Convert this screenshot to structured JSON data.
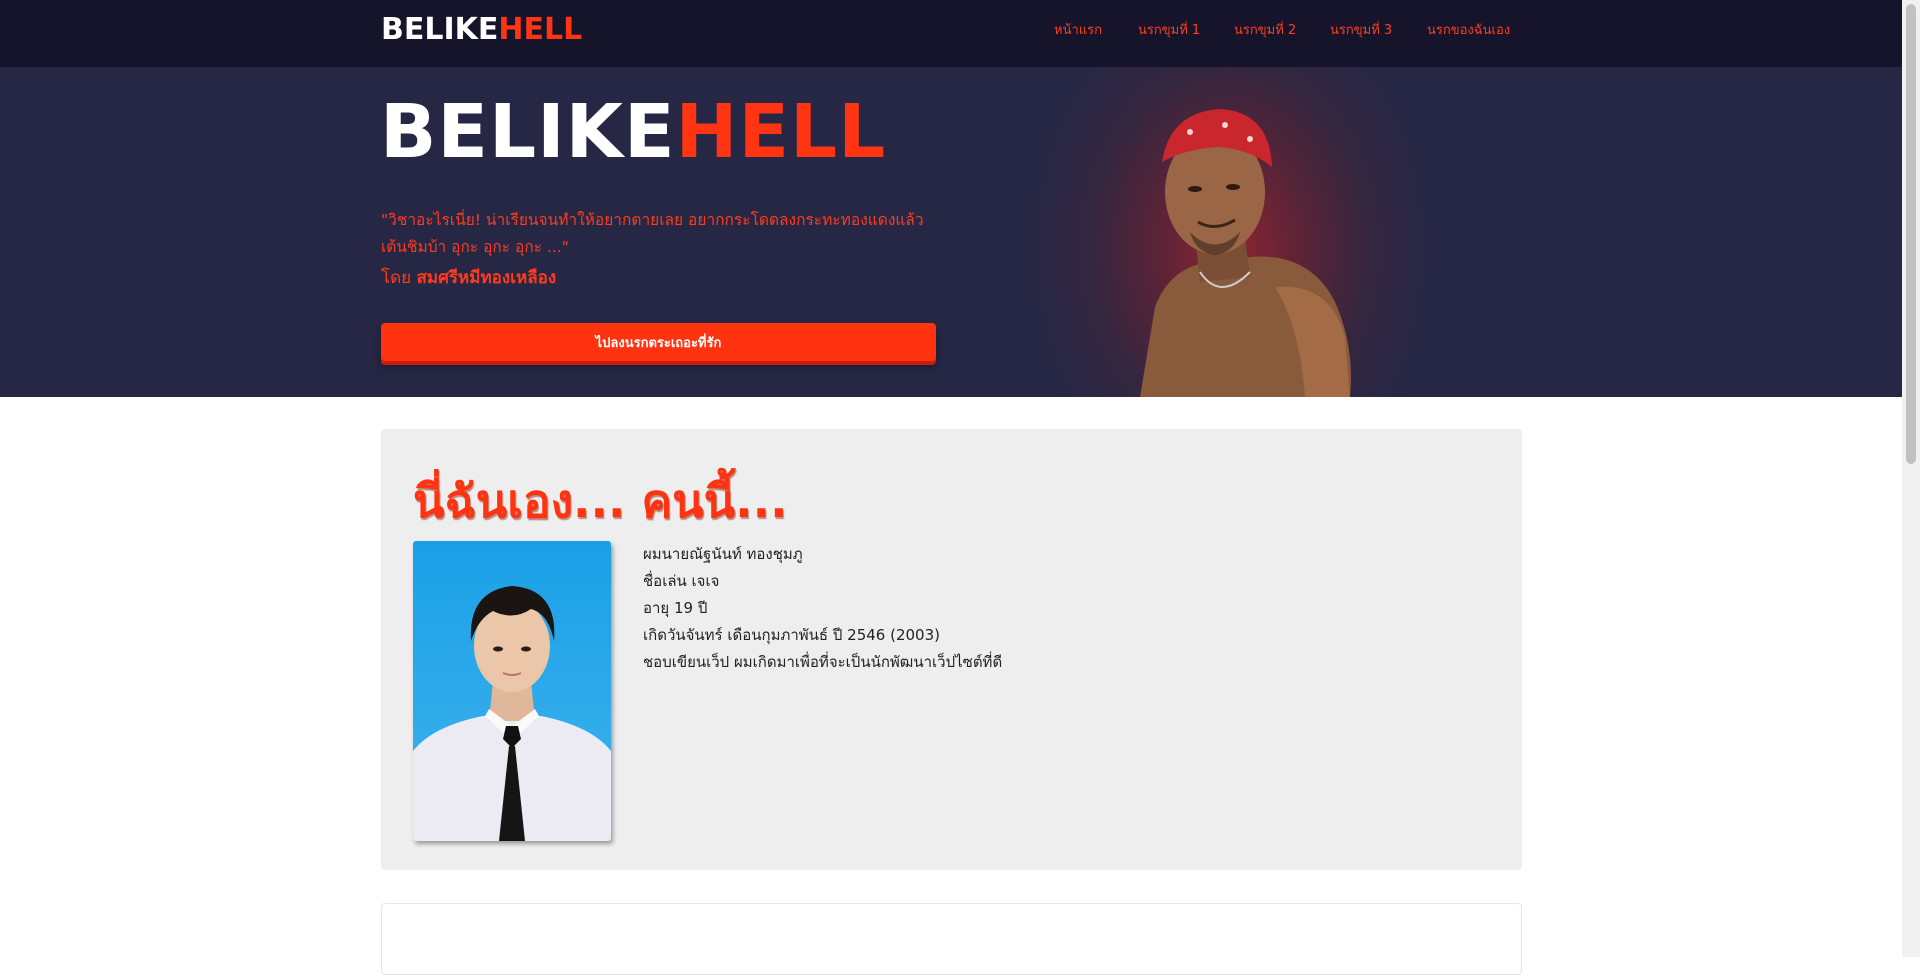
{
  "brand": {
    "part1": "BELIKE",
    "part2": "HELL"
  },
  "nav": {
    "items": [
      {
        "label": "หน้าแรก"
      },
      {
        "label": "นรกขุมที่ 1"
      },
      {
        "label": "นรกขุมที่ 2"
      },
      {
        "label": "นรกขุมที่ 3"
      },
      {
        "label": "นรกของฉันเอง"
      }
    ]
  },
  "hero": {
    "title_part1": "BELIKE",
    "title_part2": "HELL",
    "quote": "\"วิชาอะไรเนี่ย! น่าเรียนจนทำให้อยากตายเลย อยากกระโดดลงกระทะทองแดงแล้วเต้นชิมบ้า อุกะ อุกะ อุกะ ...\"",
    "byline_prefix": "โดย",
    "byline_name": "สมศรีหมีทองเหลือง",
    "cta_label": "ไปลงนรกตระเถอะที่รัก"
  },
  "about": {
    "title": "นี่ฉันเอง... คนนี้...",
    "lines": [
      "ผมนายณัฐนันท์ ทองชุมภู",
      "ชื่อเล่น เจเจ",
      "อายุ 19 ปี",
      "เกิดวันจันทร์ เดือนกุมภาพันธ์ ปี 2546 (2003)",
      "ชอบเขียนเว็ป ผมเกิดมาเพื่อที่จะเป็นนักพัฒนาเว็ปไซต์ที่ดี"
    ]
  },
  "colors": {
    "accent": "#ff3310",
    "nav_bg": "#15142a",
    "hero_bg": "#262745",
    "card_bg": "#eeeeee"
  }
}
